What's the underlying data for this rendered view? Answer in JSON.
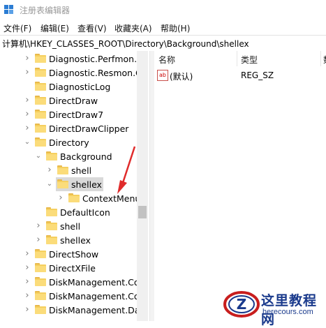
{
  "window": {
    "title": "注册表编辑器",
    "app_icon": "regedit-icon"
  },
  "menu": [
    {
      "label": "文件(F)"
    },
    {
      "label": "编辑(E)"
    },
    {
      "label": "查看(V)"
    },
    {
      "label": "收藏夹(A)"
    },
    {
      "label": "帮助(H)"
    }
  ],
  "address": "计算机\\HKEY_CLASSES_ROOT\\Directory\\Background\\shellex",
  "tree": [
    {
      "label": "Diagnostic.Perfmon.D",
      "expander": "collapsed"
    },
    {
      "label": "Diagnostic.Resmon.C",
      "expander": "collapsed"
    },
    {
      "label": "DiagnosticLog",
      "expander": "none"
    },
    {
      "label": "DirectDraw",
      "expander": "collapsed"
    },
    {
      "label": "DirectDraw7",
      "expander": "collapsed"
    },
    {
      "label": "DirectDrawClipper",
      "expander": "collapsed"
    },
    {
      "label": "Directory",
      "expander": "expanded"
    },
    {
      "label": "Background",
      "expander": "expanded"
    },
    {
      "label": "shell",
      "expander": "collapsed"
    },
    {
      "label": "shellex",
      "expander": "expanded",
      "selected": true
    },
    {
      "label": "ContextMenu",
      "expander": "collapsed"
    },
    {
      "label": "DefaultIcon",
      "expander": "none"
    },
    {
      "label": "shell",
      "expander": "collapsed"
    },
    {
      "label": "shellex",
      "expander": "collapsed"
    },
    {
      "label": "DirectShow",
      "expander": "collapsed"
    },
    {
      "label": "DirectXFile",
      "expander": "collapsed"
    },
    {
      "label": "DiskManagement.Con",
      "expander": "collapsed"
    },
    {
      "label": "DiskManagement.Con",
      "expander": "collapsed"
    },
    {
      "label": "DiskManagement.Dat",
      "expander": "collapsed"
    }
  ],
  "columns": {
    "name": "名称",
    "type": "类型",
    "data": "数"
  },
  "values": [
    {
      "name": "(默认)",
      "type": "REG_SZ",
      "icon": "string-value-icon",
      "icon_text": "ab"
    }
  ],
  "watermark": {
    "line1": "这里教程网",
    "line2": "herecours.com",
    "logo_letter": "Z"
  },
  "colors": {
    "selection": "#d9d9d9",
    "folder": "#f5cf5e",
    "annotation_arrow": "#e02b2b",
    "watermark_blue": "#1a3a8c"
  }
}
